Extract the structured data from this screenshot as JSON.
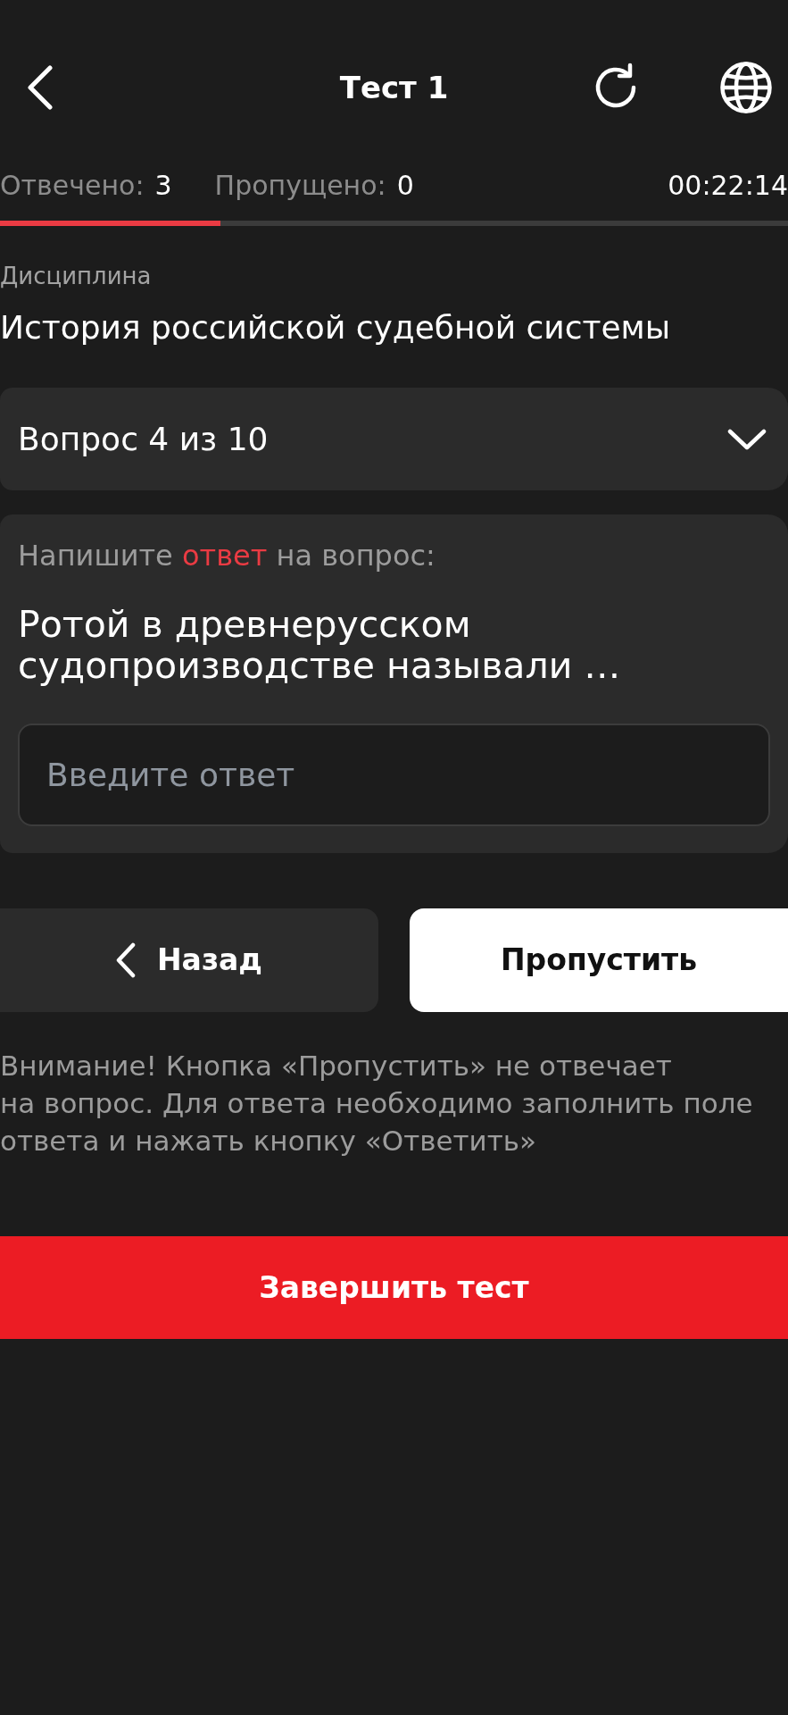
{
  "header": {
    "title": "Тест 1"
  },
  "stats": [
    {
      "label": "Отвечено:",
      "value": "3"
    },
    {
      "label": "Пропущено:",
      "value": "0"
    }
  ],
  "timer": "00:22:14",
  "progress": {
    "level": 0.28
  },
  "discipline": {
    "label": "Дисциплина",
    "value": "История российской судебной системы"
  },
  "question_selector": {
    "label": "Вопрос 4 из 10",
    "expanded": false
  },
  "question": {
    "prompt": [
      {
        "text": "Напишите ",
        "kind": "plain"
      },
      {
        "text": "ответ",
        "kind": "accent"
      },
      {
        "text": " на вопрос:",
        "kind": "plain"
      }
    ],
    "text": "Ротой в древнерусском судопроизводстве называли …",
    "answer_field": {
      "placeholder": "Введите ответ"
    }
  },
  "buttons": [
    {
      "label": "Назад",
      "kind": "back"
    },
    {
      "label": "Пропустить",
      "kind": "skip"
    }
  ],
  "notice": {
    "lines": [
      "Внимание! Кнопка «Пропустить» не отвечает",
      "на вопрос. Для ответа необходимо заполнить поле",
      "ответа и нажать кнопку «Ответить»"
    ]
  },
  "finish_button": {
    "label": "Завершить тест"
  }
}
